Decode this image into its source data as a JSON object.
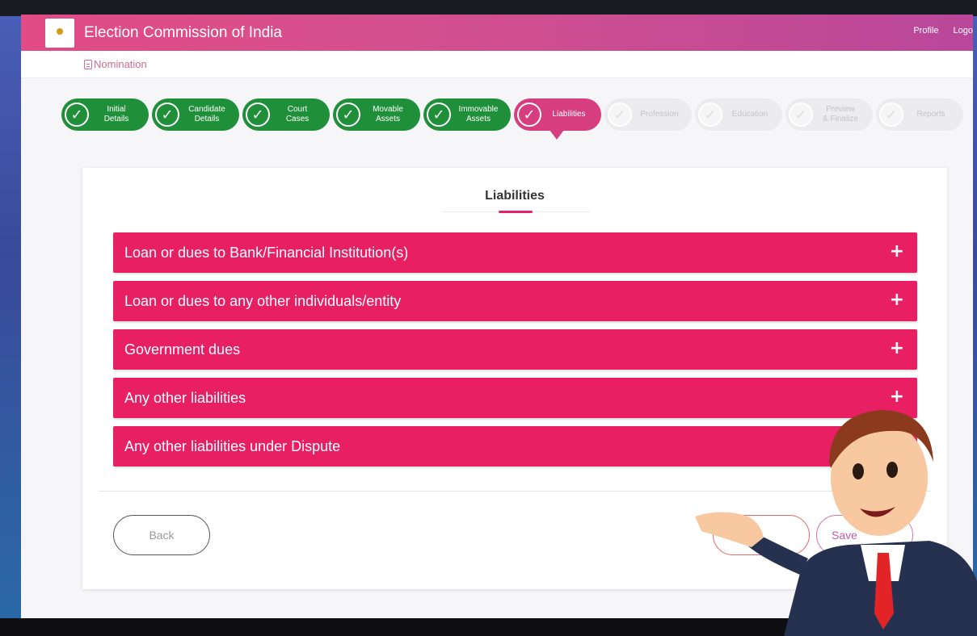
{
  "header": {
    "app_title": "Election Commission of India",
    "profile_link": "Profile",
    "logout_link": "Logo"
  },
  "breadcrumb": {
    "label": "Nomination"
  },
  "steps": [
    {
      "label": "Initial\nDetails",
      "state": "done"
    },
    {
      "label": "Candidate\nDetails",
      "state": "done"
    },
    {
      "label": "Court\nCases",
      "state": "done"
    },
    {
      "label": "Movable\nAssets",
      "state": "done"
    },
    {
      "label": "Immovable\nAssets",
      "state": "done"
    },
    {
      "label": "Liabilities",
      "state": "active"
    },
    {
      "label": "Profession",
      "state": "pending"
    },
    {
      "label": "Education",
      "state": "pending"
    },
    {
      "label": "Preview\n& Finalize",
      "state": "pending"
    },
    {
      "label": "Reports",
      "state": "pending"
    }
  ],
  "card": {
    "title": "Liabilities",
    "sections": [
      {
        "label": "Loan or dues to Bank/Financial Institution(s)",
        "icon": "+"
      },
      {
        "label": "Loan or dues to any other individuals/entity",
        "icon": "+"
      },
      {
        "label": "Government dues",
        "icon": "+"
      },
      {
        "label": "Any other liabilities",
        "icon": "+"
      },
      {
        "label": "Any other liabilities under Dispute",
        "icon": "+"
      }
    ],
    "back_label": "Back",
    "save_label": "Save"
  },
  "colors": {
    "accent": "#e81f63",
    "step_done": "#1f8f3a",
    "step_active": "#d73e80"
  }
}
